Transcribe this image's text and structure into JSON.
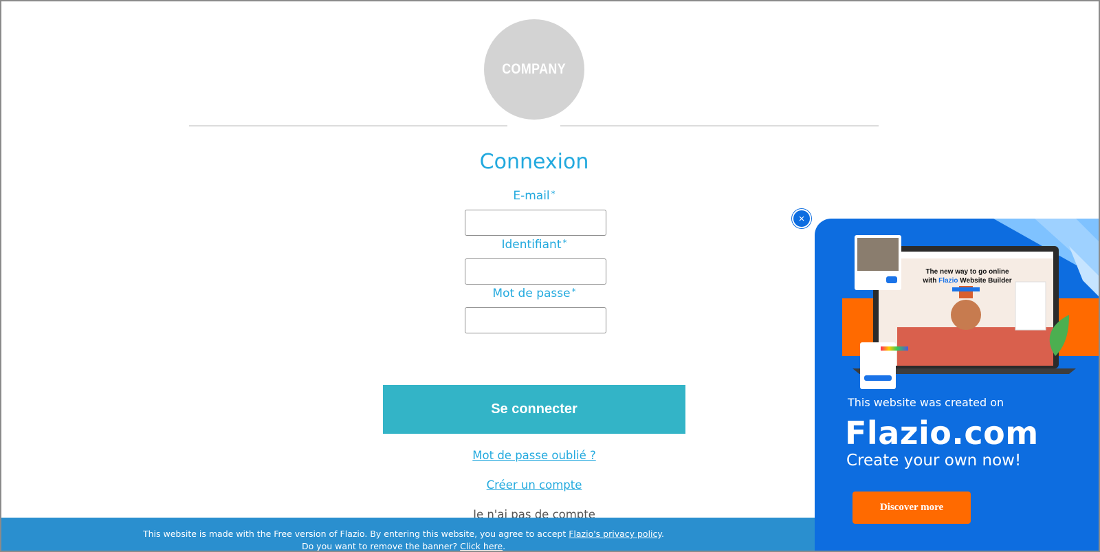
{
  "header": {
    "logo_text": "COMPANY"
  },
  "form": {
    "title": "Connexion",
    "fields": [
      {
        "label": "E-mail",
        "required_mark": "*",
        "value": ""
      },
      {
        "label": "Identifiant",
        "required_mark": "*",
        "value": ""
      },
      {
        "label": "Mot de passe",
        "required_mark": "*",
        "value": ""
      }
    ],
    "submit_label": "Se connecter",
    "forgot_password_label": "Mot de passe oublié ?",
    "create_account_label": "Créer un compte",
    "no_account_text": "Je n'ai pas de compte"
  },
  "banner": {
    "line1_text": "This website is made with the Free version of Flazio. By entering this website, you agree to accept ",
    "privacy_link": "Flazio's privacy policy",
    "line1_end": ".",
    "line2_text": "Do you want to remove the banner? ",
    "click_link": "Click here",
    "line2_end": "."
  },
  "promo": {
    "close_symbol": "×",
    "mockup_headline_1": "The new way to go online",
    "mockup_headline_2_pre": "with ",
    "mockup_headline_2_brand": "Flazio",
    "mockup_headline_2_post": " Website Builder",
    "subtitle": "This website was created on",
    "brand": "Flazio.com",
    "cta_text": "Create your own now!",
    "button_label": "Discover more"
  },
  "colors": {
    "accent": "#22a9de",
    "submit": "#33b4c7",
    "banner": "#2a8fcf",
    "promo_bg": "#0d6de0",
    "promo_button": "#ff6a00"
  }
}
